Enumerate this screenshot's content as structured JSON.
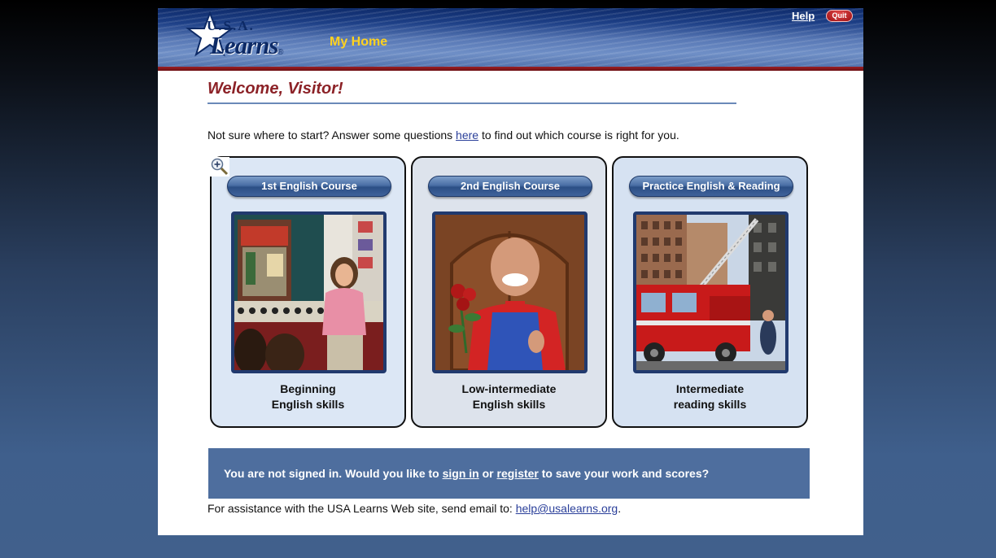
{
  "header": {
    "logo_usa": "U.S.A.",
    "logo_learns": "Learns",
    "logo_reg": "®",
    "section_title": "My Home",
    "help_label": "Help",
    "quit_label": "Quit"
  },
  "welcome": {
    "heading": "Welcome, Visitor!",
    "intro_before": "Not sure where to start? Answer some questions ",
    "intro_link": "here",
    "intro_after": " to find out which course is right for you."
  },
  "courses": [
    {
      "button": "1st English Course",
      "caption_line1": "Beginning",
      "caption_line2": "English skills",
      "image": "teacher-in-classroom"
    },
    {
      "button": "2nd English Course",
      "caption_line1": "Low-intermediate",
      "caption_line2": "English skills",
      "image": "man-with-roses"
    },
    {
      "button": "Practice English & Reading",
      "caption_line1": "Intermediate",
      "caption_line2": "reading skills",
      "image": "fire-truck"
    }
  ],
  "signin_bar": {
    "before": "You are not signed in. Would you like to ",
    "signin_link": "sign in",
    "middle": " or ",
    "register_link": "register",
    "after": " to save your work and scores?"
  },
  "footer": {
    "before": "For assistance with the USA Learns Web site, send email to: ",
    "email": "help@usalearns.org",
    "after": "."
  },
  "icons": {
    "zoom": "zoom-in-icon",
    "logo_star": "star-icon"
  },
  "colors": {
    "header_blue": "#1d3f86",
    "brand_red": "#8c2227",
    "title_yellow": "#ffd21f",
    "signin_bar": "#4e6e9e"
  }
}
